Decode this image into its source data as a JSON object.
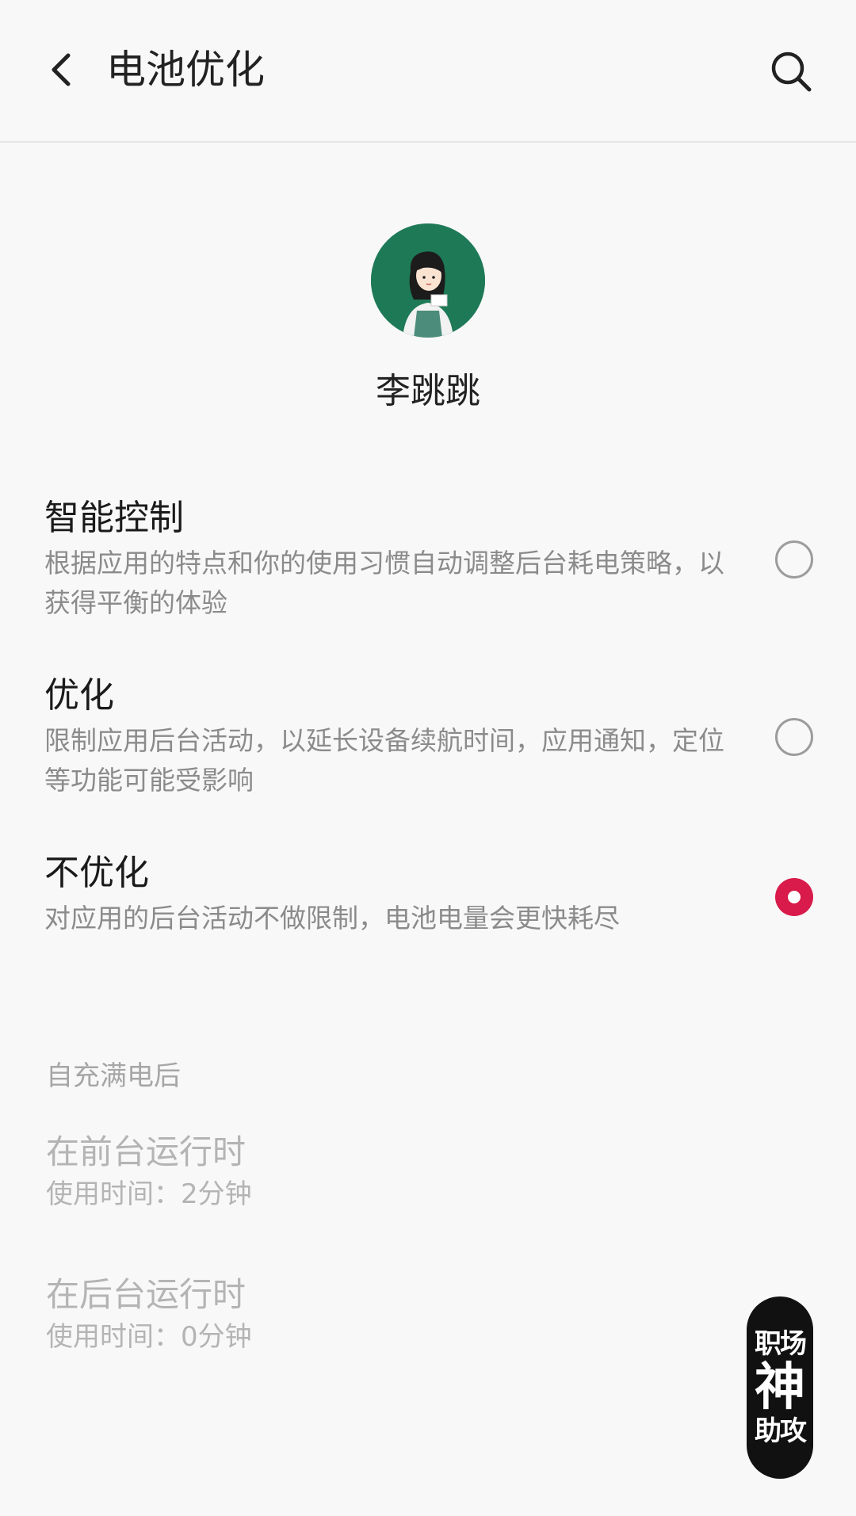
{
  "header": {
    "title": "电池优化"
  },
  "app": {
    "name": "李跳跳"
  },
  "options": [
    {
      "title": "智能控制",
      "description": "根据应用的特点和你的使用习惯自动调整后台耗电策略，以获得平衡的体验",
      "selected": false
    },
    {
      "title": "优化",
      "description": "限制应用后台活动，以延长设备续航时间，应用通知，定位等功能可能受影响",
      "selected": false
    },
    {
      "title": "不优化",
      "description": "对应用的后台活动不做限制，电池电量会更快耗尽",
      "selected": true
    }
  ],
  "usage": {
    "section_title": "自充满电后",
    "items": [
      {
        "title": "在前台运行时",
        "value": "使用时间：2分钟"
      },
      {
        "title": "在后台运行时",
        "value": "使用时间：0分钟"
      }
    ]
  },
  "watermark": {
    "line1": "职场",
    "line2": "神",
    "line3": "助攻"
  },
  "colors": {
    "accent": "#d81b4a",
    "avatar_bg": "#1e7a56"
  }
}
